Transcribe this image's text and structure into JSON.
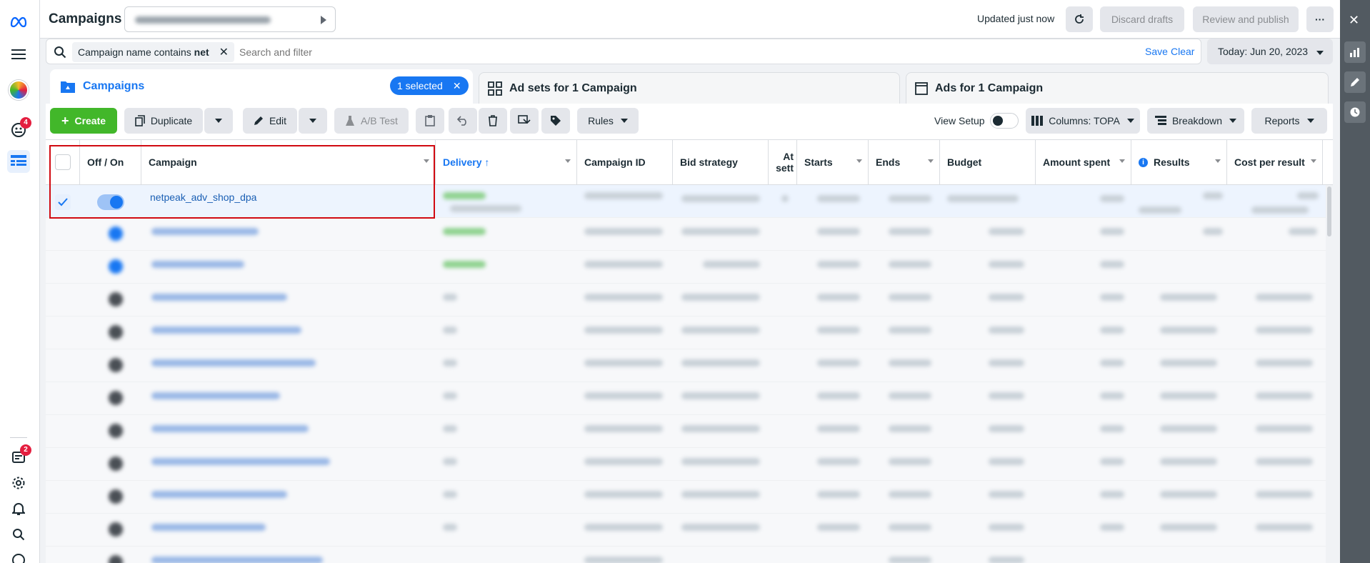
{
  "header": {
    "title": "Campaigns",
    "status": "Updated just now",
    "discard_label": "Discard drafts",
    "publish_label": "Review and publish",
    "more_label": "···"
  },
  "filter": {
    "chip_text": "Campaign name contains ",
    "chip_value": "net",
    "placeholder": "Search and filter",
    "save_label": "Save",
    "clear_label": "Clear",
    "date_label": "Today: Jun 20, 2023"
  },
  "tabs": {
    "campaigns": "Campaigns",
    "selected_badge": "1 selected",
    "adsets": "Ad sets for 1 Campaign",
    "ads": "Ads for 1 Campaign"
  },
  "toolbar": {
    "create": "Create",
    "duplicate": "Duplicate",
    "edit": "Edit",
    "abtest": "A/B Test",
    "rules": "Rules",
    "view_setup": "View Setup",
    "columns": "Columns: TOPA",
    "breakdown": "Breakdown",
    "reports": "Reports"
  },
  "table": {
    "headers": [
      "Off / On",
      "Campaign",
      "Delivery ↑",
      "Campaign ID",
      "Bid strategy",
      "At sett",
      "Starts",
      "Ends",
      "Budget",
      "Amount spent",
      "Results",
      "Cost per result"
    ],
    "first_row_campaign": "netpeak_adv_shop_dpa"
  },
  "leftrail": {
    "notifications_badge": "4",
    "bottom_badge": "2"
  },
  "colors": {
    "accent": "#1877f2",
    "create_green": "#42b72a",
    "highlight_red": "#e41e3f"
  }
}
